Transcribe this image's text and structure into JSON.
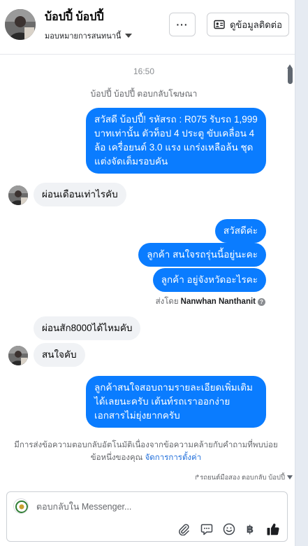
{
  "header": {
    "name": "บ้อปปี้ บ้อปปี้",
    "assignee_label": "มอบหมายการสนทนานี้",
    "more_label": "···",
    "contact_button_label": "ดูข้อมูลติดต่อ"
  },
  "chat": {
    "timestamp": "16:50",
    "system_reply_note": "บ้อปปี้ บ้อปปี้ ตอบกลับโฆษณา",
    "messages": [
      {
        "sender": "page",
        "text": "สวัสดี บ้อปปี้! รหัสรถ : R075 รับรถ 1,999 บาทเท่านั้น ตัวท็อป 4 ประตู ขับเคลื่อน 4 ล้อ  เครื่อยนต์ 3.0 แรง แกร่งเหลือล้น ชุดแต่งจัดเต็มรอบคัน"
      },
      {
        "sender": "customer",
        "text": "ผ่อนเดือนเท่าไรคับ"
      },
      {
        "sender": "page",
        "text": "สวัสดีค่ะ"
      },
      {
        "sender": "page",
        "text": "ลูกค้า สนใจรถรุ่นนี้อยู่นะคะ"
      },
      {
        "sender": "page",
        "text": "ลูกค้า อยู่จังหวัดอะไรคะ"
      },
      {
        "sender": "customer",
        "text": "ผ่อนสัก8000ได้ไหมคับ"
      },
      {
        "sender": "customer",
        "text": "สนใจคับ"
      },
      {
        "sender": "page",
        "text": "ลูกค้าสนใจสอบถามรายละเอียดเพิ่มเติม ได้เลยนะครับ เต้นท์รถเราออกง่าย เอกสารไม่ยุ่งยากครับ"
      }
    ],
    "sent_by_prefix": "ส่งโดย",
    "sent_by_name": "Nanwhan Nanthanit",
    "auto_reply_note": "มีการส่งข้อความตอบกลับอัตโนมัติเนื่องจากข้อความคล้ายกับคำถามที่พบบ่อยข้อหนึ่งของคุณ",
    "auto_reply_link": "จัดการการตั้งค่า",
    "source_note": "รถยนต์มือสอง ตอบกลับ บ้อปปี้"
  },
  "composer": {
    "placeholder": "ตอบกลับใน Messenger...",
    "baht_glyph": "฿"
  },
  "icons": {
    "more": "more-horizontal-icon",
    "contact": "contact-card-icon",
    "attach": "paperclip-icon",
    "saved_reply": "chat-bubble-icon",
    "emoji": "smiley-icon",
    "payment": "baht-icon",
    "like": "thumbs-up-icon"
  },
  "colors": {
    "outgoing_bubble": "#0a7cff",
    "incoming_bubble": "#f0f2f5",
    "link": "#216fdb"
  }
}
